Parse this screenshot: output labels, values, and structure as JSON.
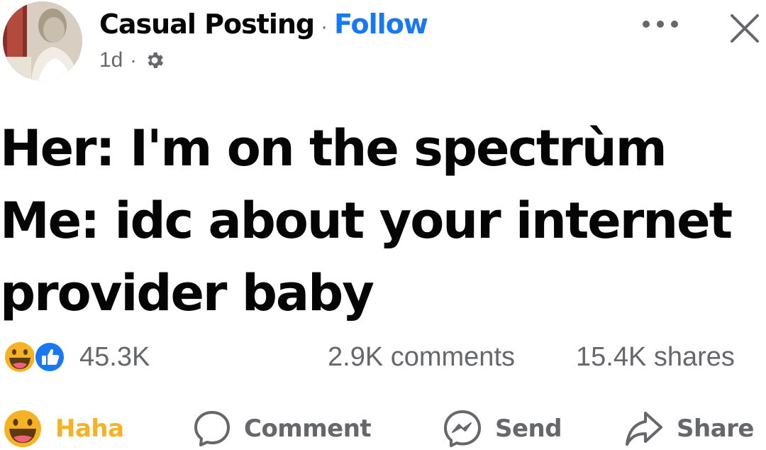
{
  "post": {
    "author": "Casual Posting",
    "separator": "·",
    "follow_label": "Follow",
    "time": "1d",
    "time_separator": "·",
    "privacy_icon": "gear-icon",
    "text_lines": [
      "Her: I'm on the spectrùm",
      "Me: idc about your internet",
      "provider baby"
    ]
  },
  "stats": {
    "reactions": [
      "haha",
      "like"
    ],
    "reaction_count": "45.3K",
    "comments": "2.9K comments",
    "shares": "15.4K shares"
  },
  "actions": {
    "haha": "Haha",
    "comment": "Comment",
    "send": "Send",
    "share": "Share"
  },
  "colors": {
    "accent": "#1877f2",
    "haha": "#f7b125",
    "muted": "#65676b",
    "text": "#050505"
  }
}
